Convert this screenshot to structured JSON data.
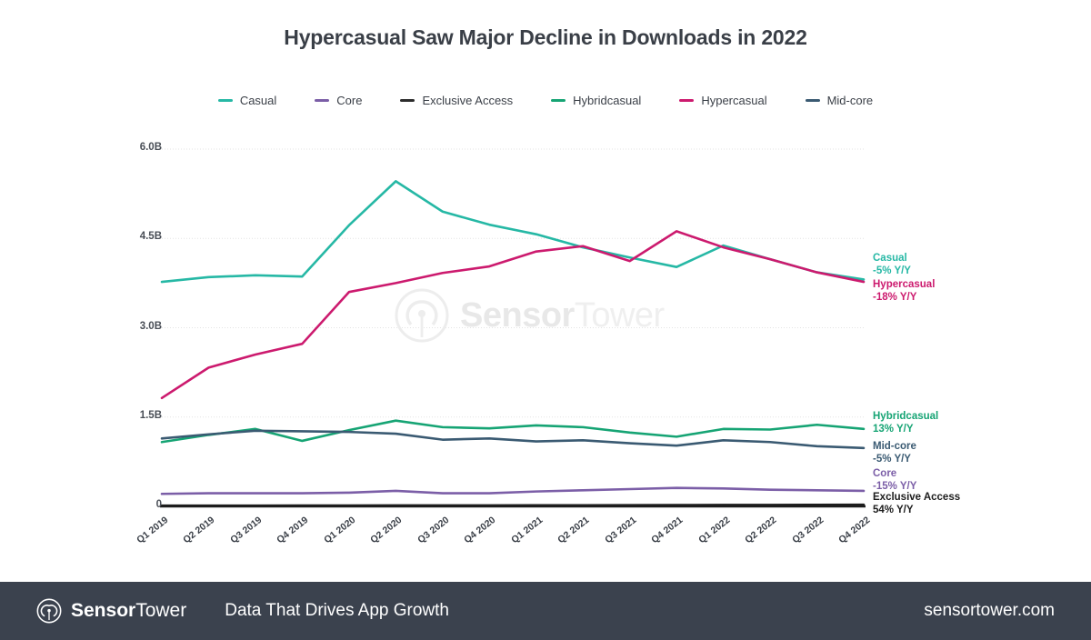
{
  "title": "Hypercasual Saw Major Decline in Downloads in 2022",
  "legend": [
    {
      "label": "Casual",
      "color": "#26b8a5"
    },
    {
      "label": "Core",
      "color": "#7b5ea7"
    },
    {
      "label": "Exclusive Access",
      "color": "#2c2c2c"
    },
    {
      "label": "Hybridcasual",
      "color": "#16a474"
    },
    {
      "label": "Hypercasual",
      "color": "#cc1a6e"
    },
    {
      "label": "Mid-core",
      "color": "#3a5a72"
    }
  ],
  "annotations": [
    {
      "name": "Casual",
      "value": "-5% Y/Y",
      "color": "#26b8a5"
    },
    {
      "name": "Hypercasual",
      "value": "-18% Y/Y",
      "color": "#cc1a6e"
    },
    {
      "name": "Hybridcasual",
      "value": "13% Y/Y",
      "color": "#16a474"
    },
    {
      "name": "Mid-core",
      "value": "-5% Y/Y",
      "color": "#3a5a72"
    },
    {
      "name": "Core",
      "value": "-15% Y/Y",
      "color": "#7b5ea7"
    },
    {
      "name": "Exclusive Access",
      "value": "54% Y/Y",
      "color": "#1d1d1d"
    }
  ],
  "watermark": {
    "bold": "Sensor",
    "light": "Tower"
  },
  "footer": {
    "brand_bold": "Sensor",
    "brand_light": "Tower",
    "tagline": "Data That Drives App Growth",
    "url": "sensortower.com"
  },
  "chart_data": {
    "type": "line",
    "title": "Hypercasual Saw Major Decline in Downloads in 2022",
    "xlabel": "",
    "ylabel": "",
    "grid": true,
    "legend_position": "top",
    "ylim": [
      0,
      6000000000
    ],
    "ytick_labels": [
      "0",
      "1.5B",
      "3.0B",
      "4.5B",
      "6.0B"
    ],
    "ytick_values": [
      0,
      1500000000,
      3000000000,
      4500000000,
      6000000000
    ],
    "categories": [
      "Q1 2019",
      "Q2 2019",
      "Q3 2019",
      "Q4 2019",
      "Q1 2020",
      "Q2 2020",
      "Q3 2020",
      "Q4 2020",
      "Q1 2021",
      "Q2 2021",
      "Q3 2021",
      "Q4 2021",
      "Q1 2022",
      "Q2 2022",
      "Q3 2022",
      "Q4 2022"
    ],
    "series": [
      {
        "name": "Casual",
        "color": "#26b8a5",
        "values": [
          3.77,
          3.85,
          3.88,
          3.86,
          4.72,
          5.46,
          4.95,
          4.73,
          4.57,
          4.35,
          4.18,
          4.02,
          4.38,
          4.15,
          3.93,
          3.81
        ]
      },
      {
        "name": "Hypercasual",
        "color": "#cc1a6e",
        "values": [
          1.82,
          2.33,
          2.55,
          2.73,
          3.6,
          3.75,
          3.92,
          4.03,
          4.28,
          4.37,
          4.12,
          4.62,
          4.35,
          4.15,
          3.93,
          3.77
        ]
      },
      {
        "name": "Hybridcasual",
        "color": "#16a474",
        "values": [
          1.08,
          1.2,
          1.3,
          1.1,
          1.28,
          1.44,
          1.33,
          1.31,
          1.36,
          1.33,
          1.24,
          1.17,
          1.3,
          1.29,
          1.37,
          1.3
        ]
      },
      {
        "name": "Mid-core",
        "color": "#3a5a72",
        "values": [
          1.14,
          1.21,
          1.27,
          1.26,
          1.25,
          1.22,
          1.12,
          1.14,
          1.09,
          1.11,
          1.06,
          1.02,
          1.11,
          1.08,
          1.01,
          0.98
        ]
      },
      {
        "name": "Core",
        "color": "#7b5ea7",
        "values": [
          0.21,
          0.22,
          0.22,
          0.22,
          0.23,
          0.26,
          0.22,
          0.22,
          0.25,
          0.27,
          0.29,
          0.31,
          0.3,
          0.28,
          0.27,
          0.26
        ]
      },
      {
        "name": "Exclusive Access",
        "color": "#1d1d1d",
        "values": [
          0.012,
          0.013,
          0.013,
          0.014,
          0.015,
          0.017,
          0.016,
          0.017,
          0.018,
          0.019,
          0.02,
          0.022,
          0.024,
          0.025,
          0.026,
          0.028
        ]
      }
    ],
    "value_unit": "billions"
  }
}
